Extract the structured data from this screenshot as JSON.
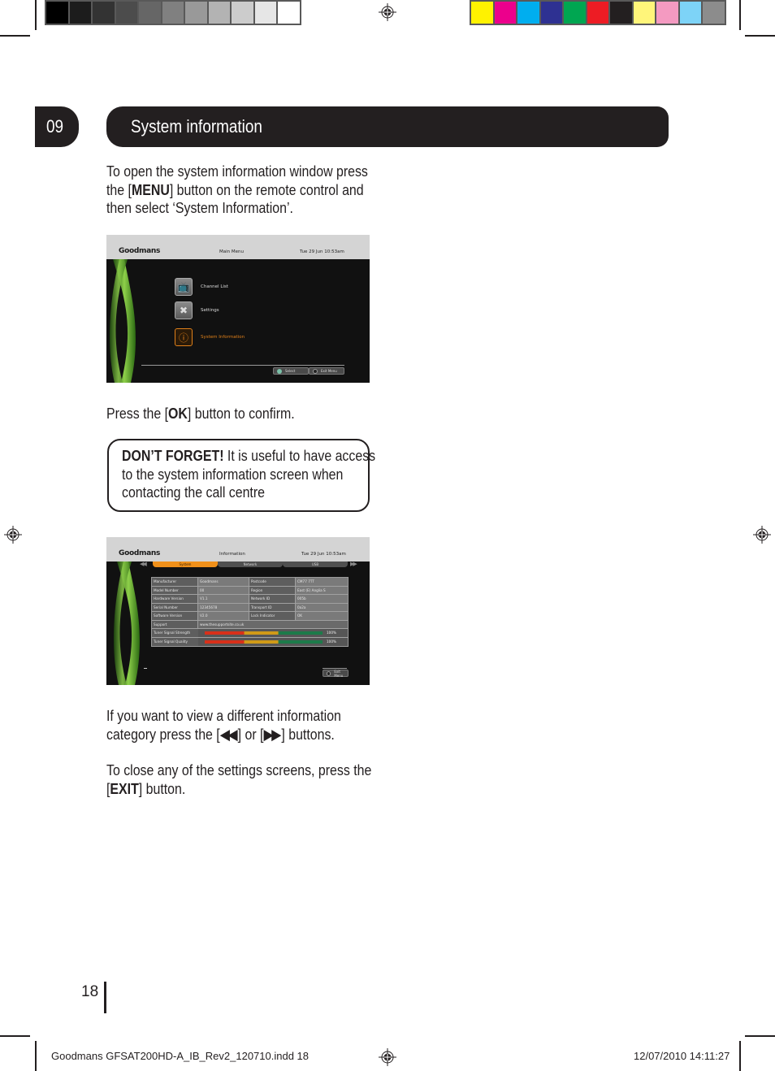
{
  "print_marks": {
    "gray_swatches": [
      "#000000",
      "#1c1c1c",
      "#333333",
      "#4c4c4c",
      "#666666",
      "#808080",
      "#999999",
      "#b3b3b3",
      "#cccccc",
      "#e6e6e6",
      "#ffffff"
    ],
    "color_swatches": [
      "#fff200",
      "#ec008c",
      "#00aeef",
      "#2e3192",
      "#00a651",
      "#ed1c24",
      "#231f20",
      "#fff57a",
      "#f49ac1",
      "#7dd3f7",
      "#8c8c8c"
    ]
  },
  "section": {
    "number": "09",
    "title": "System information"
  },
  "intro": {
    "line1": "To open the system information window press",
    "line2_pre": "the [",
    "line2_key": "MENU",
    "line2_post": "] button on the remote control and",
    "line3": "then select ‘System Information’."
  },
  "main_menu_screen": {
    "brand": "Goodmans",
    "title": "Main Menu",
    "clock": "Tue 29 Jun  10:53am",
    "items": [
      {
        "label": "Channel List",
        "icon": "tv-icon",
        "active": false
      },
      {
        "label": "Settings",
        "icon": "tools-icon",
        "active": false
      },
      {
        "label": "System Information",
        "icon": "info-icon",
        "active": true
      }
    ],
    "footer_buttons": [
      {
        "label": "Select",
        "icon": "ok-icon"
      },
      {
        "label": "Exit Menu",
        "icon": "exit-icon"
      }
    ]
  },
  "confirm": {
    "pre": "Press the [",
    "key": "OK",
    "post": "] button to confirm."
  },
  "callout": {
    "strong": "DON’T FORGET!",
    "line1": " It is useful to have access",
    "line2": "to the system information screen when",
    "line3": "contacting the call centre"
  },
  "info_screen": {
    "brand": "Goodmans",
    "title": "Information",
    "clock": "Tue 29 Jun 10:53am",
    "tabs": [
      {
        "label": "System",
        "active": true
      },
      {
        "label": "Network",
        "active": false
      },
      {
        "label": "USB",
        "active": false
      }
    ],
    "rows": [
      {
        "label": "Manufacturer",
        "value": "Goodmans",
        "label2": "Postcode",
        "value2": "CM77 7TT"
      },
      {
        "label": "Model Number",
        "value": "00",
        "label2": "Region",
        "value2": "East (E) Anglia S"
      },
      {
        "label": "Hardware Version",
        "value": "V1.1",
        "label2": "Network ID",
        "value2": "005b"
      },
      {
        "label": "Serial Number",
        "value": "12345678",
        "label2": "Transport ID",
        "value2": "0a2a"
      },
      {
        "label": "Software Version",
        "value": "V2.0",
        "label2": "Lock Indicator",
        "value2": "OK"
      }
    ],
    "support": {
      "label": "Support",
      "value": "www.thesupportsite.co.uk"
    },
    "signals": [
      {
        "label": "Tuner Signal Strength",
        "level": 1.0,
        "value": "100%"
      },
      {
        "label": "Tuner Signal Quality",
        "level": 1.0,
        "value": "100%"
      }
    ],
    "footer_button": {
      "label": "Exit Menu",
      "icon": "exit-icon"
    }
  },
  "nav_hint": {
    "line1": "If you want to view a different information",
    "line2_pre": "category press the  [",
    "rewind": "◀◀",
    "line2_mid": "] or  [",
    "forward": "▶▶",
    "line2_post": "]  buttons."
  },
  "close_hint": {
    "line1": "To close any of the settings screens, press the",
    "line2_pre": "[",
    "key": "EXIT",
    "line2_post": "] button."
  },
  "page_number": "18",
  "slug": {
    "file": "Goodmans GFSAT200HD-A_IB_Rev2_120710.indd   18",
    "date": "12/07/2010   14:11:27"
  }
}
